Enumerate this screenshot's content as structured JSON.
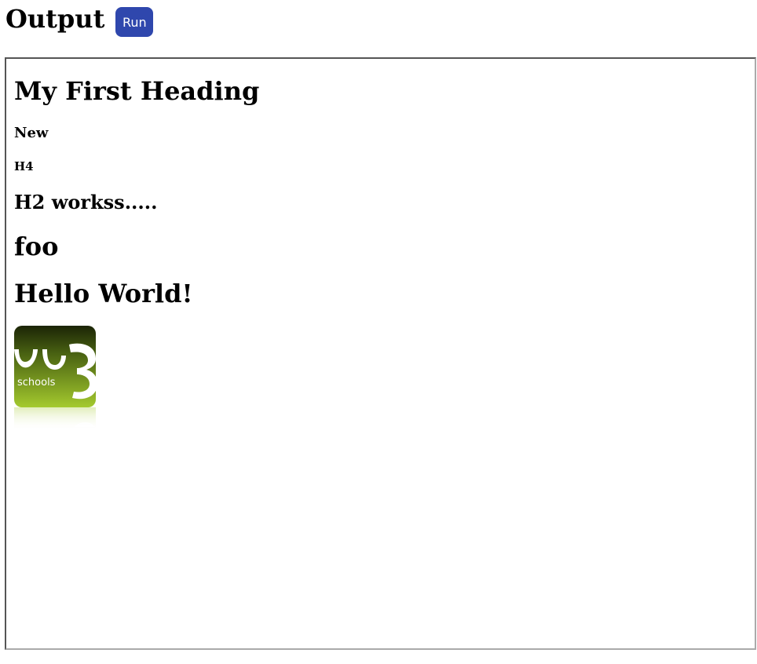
{
  "header": {
    "title": "Output",
    "run_label": "Run"
  },
  "output": {
    "heading_main": "My First Heading",
    "heading_new": "New",
    "heading_h4": "H4",
    "heading_h2": "H2 workss.....",
    "heading_foo": "foo",
    "heading_hello": "Hello World!",
    "logo": {
      "text": "schools",
      "icon": "w3schools-logo"
    }
  },
  "colors": {
    "run_button": "#2f47ad",
    "logo_dark": "#1e2a08",
    "logo_light": "#9bc32a"
  }
}
